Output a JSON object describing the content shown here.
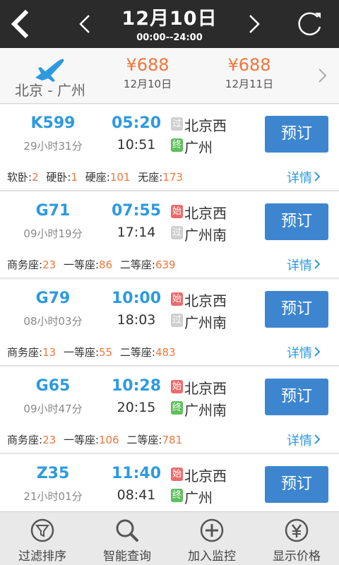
{
  "header": {
    "date": "12月10日",
    "time_range": "00:00--24:00"
  },
  "route": {
    "cities": "北京 - 广州",
    "fares": [
      {
        "price": "¥688",
        "date": "12月10日"
      },
      {
        "price": "¥688",
        "date": "12月11日"
      }
    ]
  },
  "book_label": "预订",
  "detail_label": "详情",
  "trains": [
    {
      "number": "K599",
      "duration": "29小时31分",
      "depart_time": "05:20",
      "arrive_time": "10:51",
      "from_tag": "过",
      "from_station": "北京西",
      "to_tag": "终",
      "to_station": "广州",
      "seats": [
        {
          "label": "软卧:",
          "count": "2"
        },
        {
          "label": "硬卧:",
          "count": "1"
        },
        {
          "label": "硬座:",
          "count": "101"
        },
        {
          "label": "无座:",
          "count": "173"
        }
      ]
    },
    {
      "number": "G71",
      "duration": "09小时19分",
      "depart_time": "07:55",
      "arrive_time": "17:14",
      "from_tag": "始",
      "from_station": "北京西",
      "to_tag": "过",
      "to_station": "广州南",
      "seats": [
        {
          "label": "商务座:",
          "count": "23"
        },
        {
          "label": "一等座:",
          "count": "86"
        },
        {
          "label": "二等座:",
          "count": "639"
        }
      ]
    },
    {
      "number": "G79",
      "duration": "08小时03分",
      "depart_time": "10:00",
      "arrive_time": "18:03",
      "from_tag": "始",
      "from_station": "北京西",
      "to_tag": "过",
      "to_station": "广州南",
      "seats": [
        {
          "label": "商务座:",
          "count": "13"
        },
        {
          "label": "一等座:",
          "count": "55"
        },
        {
          "label": "二等座:",
          "count": "483"
        }
      ]
    },
    {
      "number": "G65",
      "duration": "09小时47分",
      "depart_time": "10:28",
      "arrive_time": "20:15",
      "from_tag": "始",
      "from_station": "北京西",
      "to_tag": "终",
      "to_station": "广州南",
      "seats": [
        {
          "label": "商务座:",
          "count": "23"
        },
        {
          "label": "一等座:",
          "count": "106"
        },
        {
          "label": "二等座:",
          "count": "781"
        }
      ]
    },
    {
      "number": "Z35",
      "duration": "21小时01分",
      "depart_time": "11:40",
      "arrive_time": "08:41",
      "from_tag": "始",
      "from_station": "北京西",
      "to_tag": "终",
      "to_station": "广州",
      "seats": []
    }
  ],
  "bottom_nav": [
    {
      "label": "过滤排序",
      "icon": "filter-icon"
    },
    {
      "label": "智能查询",
      "icon": "search-icon"
    },
    {
      "label": "加入监控",
      "icon": "plus-circle-icon"
    },
    {
      "label": "显示价格",
      "icon": "yen-circle-icon"
    }
  ],
  "colors": {
    "accent": "#2d9ae0",
    "price": "#f0763a",
    "button": "#3d86cf",
    "topbar": "#2b2b2b",
    "tag_start": "#ec6a6a",
    "tag_end": "#5fbf5c",
    "tag_pass": "#cfcfcf"
  }
}
